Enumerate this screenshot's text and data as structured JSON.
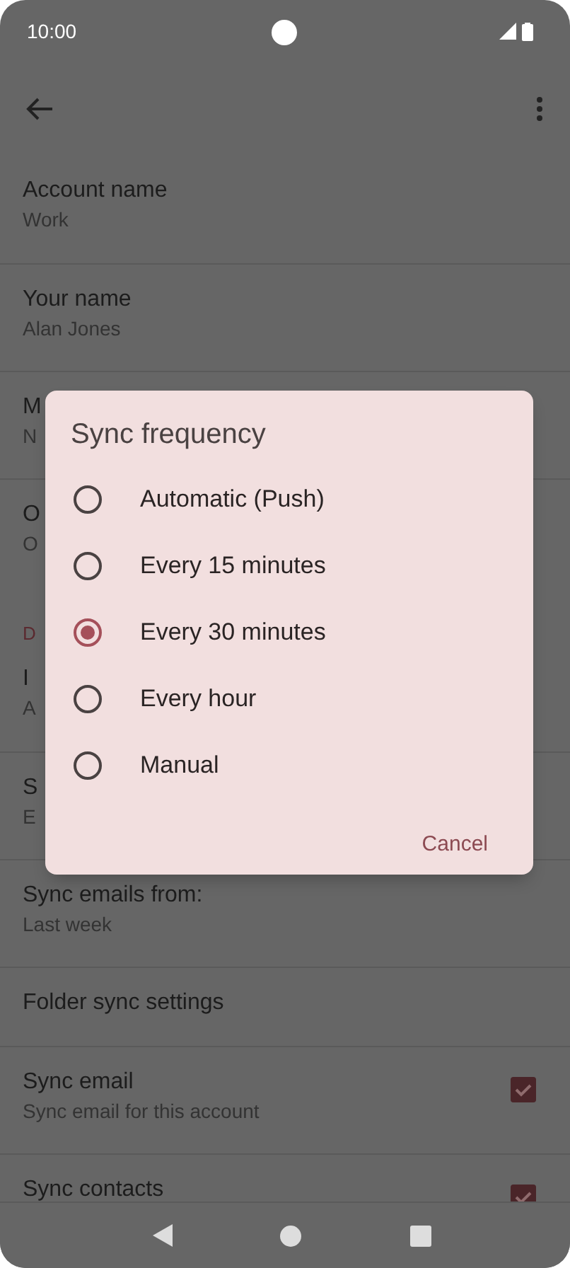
{
  "status_bar": {
    "time": "10:00"
  },
  "settings": [
    {
      "kind": "item",
      "title": "Account name",
      "summary": "Work"
    },
    {
      "kind": "item",
      "title": "Your name",
      "summary": "Alan Jones"
    },
    {
      "kind": "item",
      "title": "M",
      "summary": "N"
    },
    {
      "kind": "item",
      "title": "O",
      "summary": "O"
    },
    {
      "kind": "header",
      "title": "D"
    },
    {
      "kind": "item",
      "title": "I",
      "summary": "A"
    },
    {
      "kind": "item",
      "title": "S",
      "summary": "E"
    },
    {
      "kind": "item",
      "title": "Sync emails from:",
      "summary": "Last week"
    },
    {
      "kind": "item",
      "title": "Folder sync settings"
    },
    {
      "kind": "checkbox",
      "title": "Sync email",
      "summary": "Sync email for this account",
      "checked": true
    },
    {
      "kind": "checkbox",
      "title": "Sync contacts",
      "checked": true
    }
  ],
  "dialog": {
    "title": "Sync frequency",
    "options": [
      {
        "label": "Automatic (Push)",
        "selected": false
      },
      {
        "label": "Every 15 minutes",
        "selected": false
      },
      {
        "label": "Every 30 minutes",
        "selected": true
      },
      {
        "label": "Every hour",
        "selected": false
      },
      {
        "label": "Manual",
        "selected": false
      }
    ],
    "cancel": "Cancel"
  }
}
